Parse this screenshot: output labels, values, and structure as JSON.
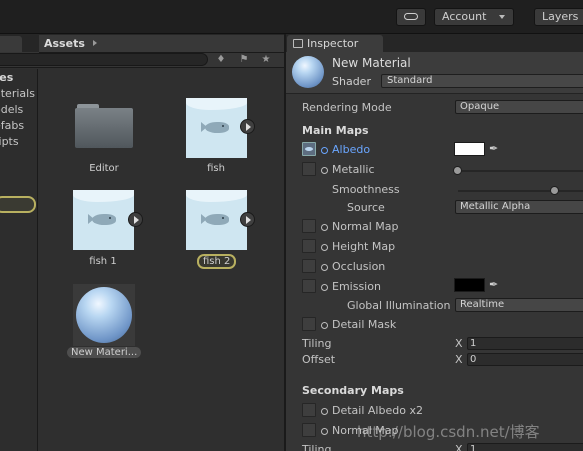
{
  "topbar": {
    "cloud_icon": "cloud-icon",
    "account_label": "Account",
    "layers_label": "Layers"
  },
  "project": {
    "folders": [
      "tes",
      "aterials",
      "odels",
      "efabs",
      "ripts"
    ],
    "assets_title": "Assets",
    "assets": [
      {
        "label": "Editor",
        "type": "folder"
      },
      {
        "label": "fish",
        "type": "texture"
      },
      {
        "label": "fish 1",
        "type": "texture"
      },
      {
        "label": "fish 2",
        "type": "texture",
        "selected": true
      },
      {
        "label": "New Materi...",
        "type": "material"
      }
    ]
  },
  "inspector": {
    "tab_label": "Inspector",
    "material_name": "New Material",
    "shader_label": "Shader",
    "shader_value": "Standard",
    "rendering_mode_label": "Rendering Mode",
    "rendering_mode_value": "Opaque",
    "main_maps_title": "Main Maps",
    "albedo_label": "Albedo",
    "albedo_color": "#ffffff",
    "metallic_label": "Metallic",
    "metallic_value": 0,
    "smoothness_label": "Smoothness",
    "smoothness_value": 0.5,
    "source_label": "Source",
    "source_value": "Metallic Alpha",
    "normal_map_label": "Normal Map",
    "height_map_label": "Height Map",
    "occlusion_label": "Occlusion",
    "emission_label": "Emission",
    "emission_color": "#000000",
    "gi_label": "Global Illumination",
    "gi_value": "Realtime",
    "detail_mask_label": "Detail Mask",
    "tiling_label": "Tiling",
    "offset_label": "Offset",
    "x_label": "X",
    "tiling_x": "1",
    "offset_x": "0",
    "secondary_maps_title": "Secondary Maps",
    "detail_albedo_label": "Detail Albedo x2",
    "normal_map2_label": "Normal Map",
    "tiling2_label": "Tiling",
    "tiling2_x": "1"
  },
  "watermark": "http://blog.csdn.net/博客",
  "colors": {
    "accent_albedo": "#6aa6ff",
    "selection_outline": "#b8b060"
  }
}
